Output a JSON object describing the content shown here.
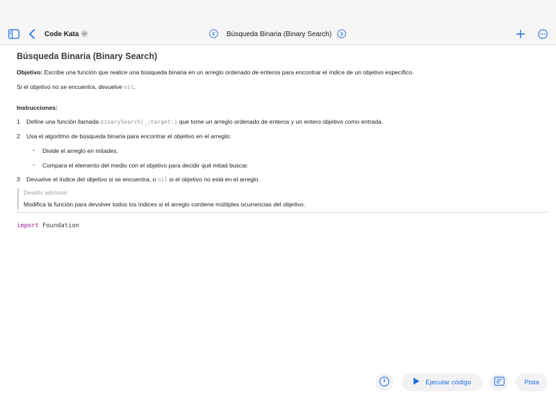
{
  "toolbar": {
    "app_title": "Code Kata",
    "doc_title": "Búsqueda Binaria (Binary Search)"
  },
  "icons": {
    "sidebar": "sidebar-icon",
    "back": "chevron-left-icon",
    "app_menu": "chevron-down-icon",
    "prev": "chevron-left-circle-icon",
    "next": "chevron-right-circle-icon",
    "add": "plus-icon",
    "more": "ellipsis-circle-icon",
    "timer": "timer-icon",
    "run": "play-icon",
    "notes": "notes-icon"
  },
  "colors": {
    "accent": "#1a6fe0",
    "keyword": "#9b2393"
  },
  "article": {
    "title": "Búsqueda Binaria (Binary Search)",
    "objective_label": "Objetivo:",
    "objective_text": " Escribe una función que realice una búsqueda binaria en un arreglo ordenado de enteros para encontrar el índice de un objetivo específico.",
    "notfound_pre": "Si el objetivo no se encuentra, devuelve ",
    "notfound_code": "nil",
    "notfound_post": ".",
    "instructions_label": "Instrucciones:",
    "steps": [
      {
        "num": "1",
        "pre": "Define una función llamada ",
        "code": "binarySearch(_:target:)",
        "post": " que tome un arreglo ordenado de enteros y un entero objetivo como entrada."
      },
      {
        "num": "2",
        "pre": "Usa el algoritmo de búsqueda binaria para encontrar el objetivo en el arreglo:"
      },
      {
        "num": "3",
        "pre": "Devuelve el índice del objetivo si se encuentra, o ",
        "code": "nil",
        "post": " si el objetivo no está en el arreglo."
      }
    ],
    "sub_bullets": [
      "Divide el arreglo en mitades.",
      "Compara el elemento del medio con el objetivo para decidir qué mitad buscar."
    ],
    "bullet_glyph": "•",
    "callout_title": "Desafío adicional",
    "callout_body": "Modifica la función para devolver todos los índices si el arreglo contiene múltiples ocurrencias del objetivo."
  },
  "editor": {
    "keyword": "import",
    "module": " Foundation"
  },
  "bottom": {
    "run_label": "Ejecutar código",
    "hint_label": "Pista"
  }
}
